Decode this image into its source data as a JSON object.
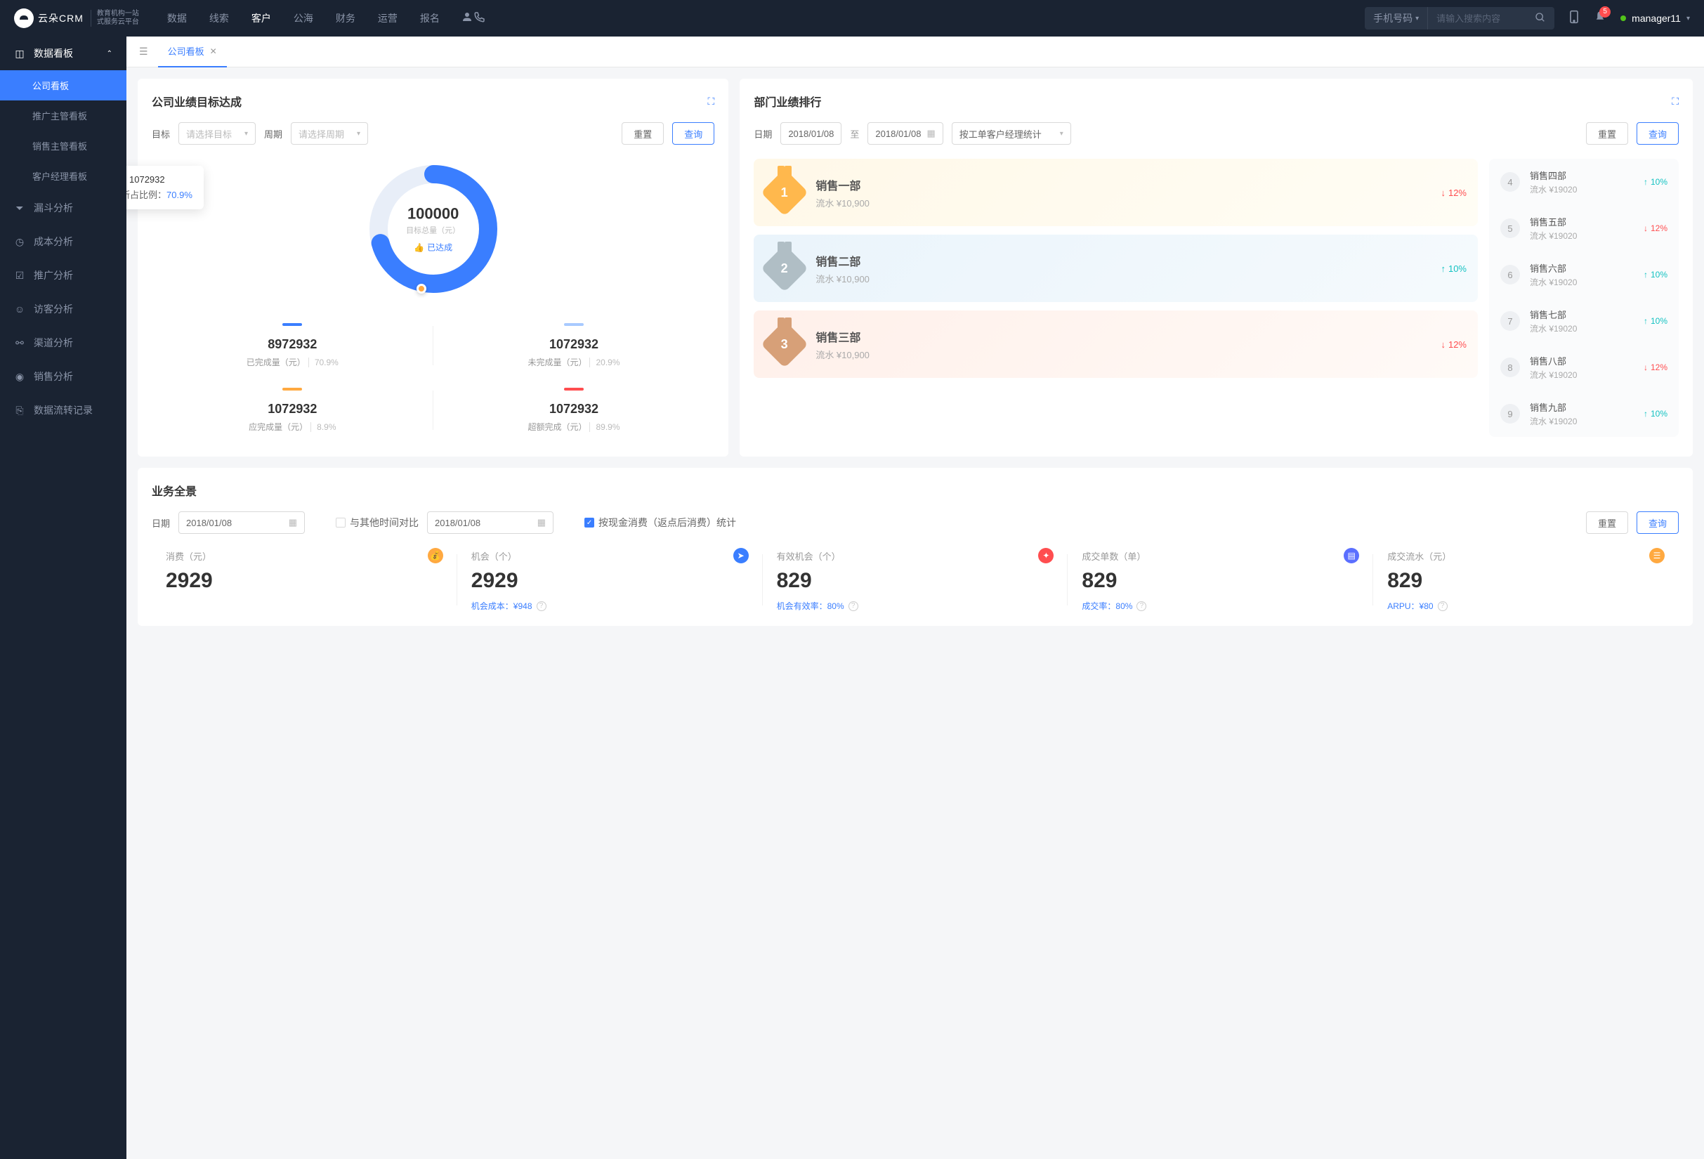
{
  "header": {
    "logo_text": "云朵CRM",
    "logo_sub1": "教育机构一站",
    "logo_sub2": "式服务云平台",
    "nav": [
      "数据",
      "线索",
      "客户",
      "公海",
      "财务",
      "运营",
      "报名"
    ],
    "nav_active_idx": 2,
    "search_type": "手机号码",
    "search_placeholder": "请输入搜索内容",
    "badge_count": "5",
    "user": "manager11"
  },
  "sidebar": {
    "group": {
      "label": "数据看板",
      "expanded": true
    },
    "subs": [
      "公司看板",
      "推广主管看板",
      "销售主管看板",
      "客户经理看板"
    ],
    "sub_active_idx": 0,
    "items": [
      {
        "icon": "filter",
        "label": "漏斗分析"
      },
      {
        "icon": "clock",
        "label": "成本分析"
      },
      {
        "icon": "chart",
        "label": "推广分析"
      },
      {
        "icon": "visitor",
        "label": "访客分析"
      },
      {
        "icon": "channel",
        "label": "渠道分析"
      },
      {
        "icon": "eye",
        "label": "销售分析"
      },
      {
        "icon": "flow",
        "label": "数据流转记录"
      }
    ]
  },
  "tabs": {
    "active": "公司看板"
  },
  "target_card": {
    "title": "公司业绩目标达成",
    "filter_target_label": "目标",
    "filter_target_placeholder": "请选择目标",
    "filter_period_label": "周期",
    "filter_period_placeholder": "请选择周期",
    "reset": "重置",
    "query": "查询",
    "donut_total": "100000",
    "donut_total_label": "目标总量（元）",
    "donut_badge": "已达成",
    "tooltip_value": "1072932",
    "tooltip_ratio_label": "所占比例：",
    "tooltip_ratio": "70.9%",
    "stats": [
      {
        "bar": "#3a7eff",
        "value": "8972932",
        "label": "已完成量（元）",
        "pct": "70.9%"
      },
      {
        "bar": "#a8caff",
        "value": "1072932",
        "label": "未完成量（元）",
        "pct": "20.9%"
      },
      {
        "bar": "#ffa940",
        "value": "1072932",
        "label": "应完成量（元）",
        "pct": "8.9%"
      },
      {
        "bar": "#ff4d4f",
        "value": "1072932",
        "label": "超额完成（元）",
        "pct": "89.9%"
      }
    ]
  },
  "chart_data": {
    "type": "pie",
    "title": "目标总量（元）",
    "total": 100000,
    "series": [
      {
        "name": "已完成量（元）",
        "value": 8972932,
        "pct": 70.9,
        "color": "#3a7eff"
      },
      {
        "name": "未完成量（元）",
        "value": 1072932,
        "pct": 20.9,
        "color": "#a8caff"
      },
      {
        "name": "应完成量（元）",
        "value": 1072932,
        "pct": 8.9,
        "color": "#ffa940"
      },
      {
        "name": "超额完成（元）",
        "value": 1072932,
        "pct": 89.9,
        "color": "#ff4d4f"
      }
    ],
    "donut_arc_visible_pct": 70.9
  },
  "rank_card": {
    "title": "部门业绩排行",
    "date_label": "日期",
    "date_from": "2018/01/08",
    "date_to": "2018/01/08",
    "date_sep": "至",
    "stat_type": "按工单客户经理统计",
    "reset": "重置",
    "query": "查询",
    "top3": [
      {
        "name": "销售一部",
        "sub": "流水 ¥10,900",
        "pct": "12%",
        "dir": "down",
        "medal": "1",
        "color": "#ffb84d"
      },
      {
        "name": "销售二部",
        "sub": "流水 ¥10,900",
        "pct": "10%",
        "dir": "up",
        "medal": "2",
        "color": "#b0bec5"
      },
      {
        "name": "销售三部",
        "sub": "流水 ¥10,900",
        "pct": "12%",
        "dir": "down",
        "medal": "3",
        "color": "#d7a078"
      }
    ],
    "rest": [
      {
        "num": "4",
        "name": "销售四部",
        "sub": "流水 ¥19020",
        "pct": "10%",
        "dir": "up"
      },
      {
        "num": "5",
        "name": "销售五部",
        "sub": "流水 ¥19020",
        "pct": "12%",
        "dir": "down"
      },
      {
        "num": "6",
        "name": "销售六部",
        "sub": "流水 ¥19020",
        "pct": "10%",
        "dir": "up"
      },
      {
        "num": "7",
        "name": "销售七部",
        "sub": "流水 ¥19020",
        "pct": "10%",
        "dir": "up"
      },
      {
        "num": "8",
        "name": "销售八部",
        "sub": "流水 ¥19020",
        "pct": "12%",
        "dir": "down"
      },
      {
        "num": "9",
        "name": "销售九部",
        "sub": "流水 ¥19020",
        "pct": "10%",
        "dir": "up"
      }
    ]
  },
  "overview": {
    "title": "业务全景",
    "date_label": "日期",
    "date1": "2018/01/08",
    "compare_label": "与其他时间对比",
    "date2": "2018/01/08",
    "check_label": "按现金消费（返点后消费）统计",
    "reset": "重置",
    "query": "查询",
    "items": [
      {
        "label": "消费（元）",
        "value": "2929",
        "foot": "",
        "icon_bg": "#ffa940",
        "icon": "💰"
      },
      {
        "label": "机会（个）",
        "value": "2929",
        "foot_label": "机会成本：",
        "foot_val": "¥948",
        "icon_bg": "#3a7eff",
        "icon": "➤"
      },
      {
        "label": "有效机会（个）",
        "value": "829",
        "foot_label": "机会有效率：",
        "foot_val": "80%",
        "icon_bg": "#ff4d4f",
        "icon": "✦"
      },
      {
        "label": "成交单数（单）",
        "value": "829",
        "foot_label": "成交率：",
        "foot_val": "80%",
        "icon_bg": "#5b6fff",
        "icon": "▤"
      },
      {
        "label": "成交流水（元）",
        "value": "829",
        "foot_label": "ARPU：",
        "foot_val": "¥80",
        "icon_bg": "#ffa940",
        "icon": "☰"
      }
    ]
  }
}
